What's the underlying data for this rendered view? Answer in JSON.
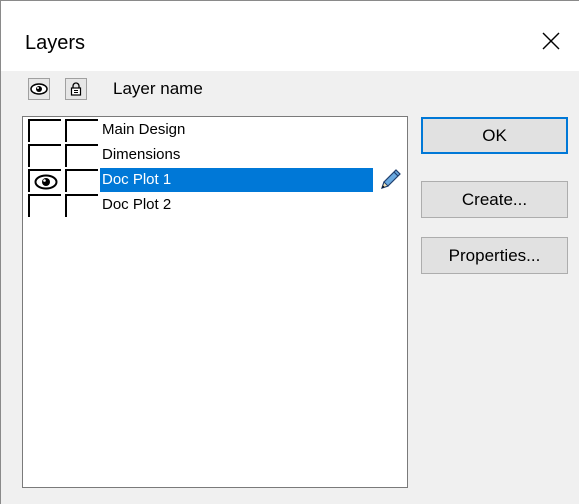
{
  "dialog": {
    "title": "Layers",
    "close_icon": "close-icon"
  },
  "header": {
    "visibility_icon": "eye-icon",
    "lock_icon": "lock-icon",
    "column_label": "Layer name"
  },
  "layers": [
    {
      "name": "Main Design",
      "visible": false,
      "locked": false,
      "selected": false
    },
    {
      "name": "Dimensions",
      "visible": false,
      "locked": false,
      "selected": false
    },
    {
      "name": "Doc Plot 1",
      "visible": true,
      "locked": false,
      "selected": true,
      "active_icon": "pencil-icon"
    },
    {
      "name": "Doc Plot 2",
      "visible": false,
      "locked": false,
      "selected": false
    }
  ],
  "buttons": {
    "ok": "OK",
    "create": "Create...",
    "properties": "Properties..."
  },
  "colors": {
    "selection": "#0078d7",
    "dialog_bg": "#f0f0f0",
    "button_bg": "#e1e1e1"
  }
}
